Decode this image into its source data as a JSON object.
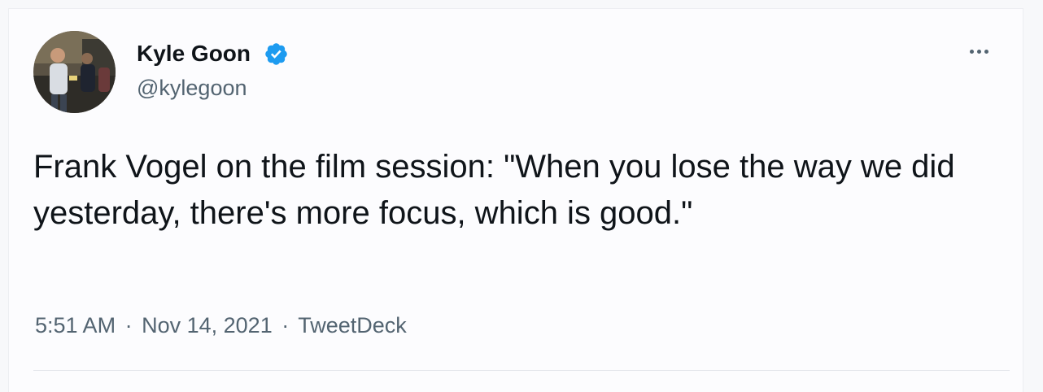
{
  "tweet": {
    "author": {
      "display_name": "Kyle Goon",
      "handle": "@kylegoon",
      "verified": true,
      "avatar_icon": "profile-photo"
    },
    "text": "Frank Vogel on the film session: \"When you lose the way we did yesterday, there's more focus, which is good.\"",
    "time": "5:51 AM",
    "separator": "·",
    "date": "Nov 14, 2021",
    "source": "TweetDeck"
  },
  "menu": {
    "icon": "more-options-icon"
  },
  "colors": {
    "verified_blue": "#1d9bf0",
    "text_primary": "#0f1419",
    "text_secondary": "#536471"
  }
}
